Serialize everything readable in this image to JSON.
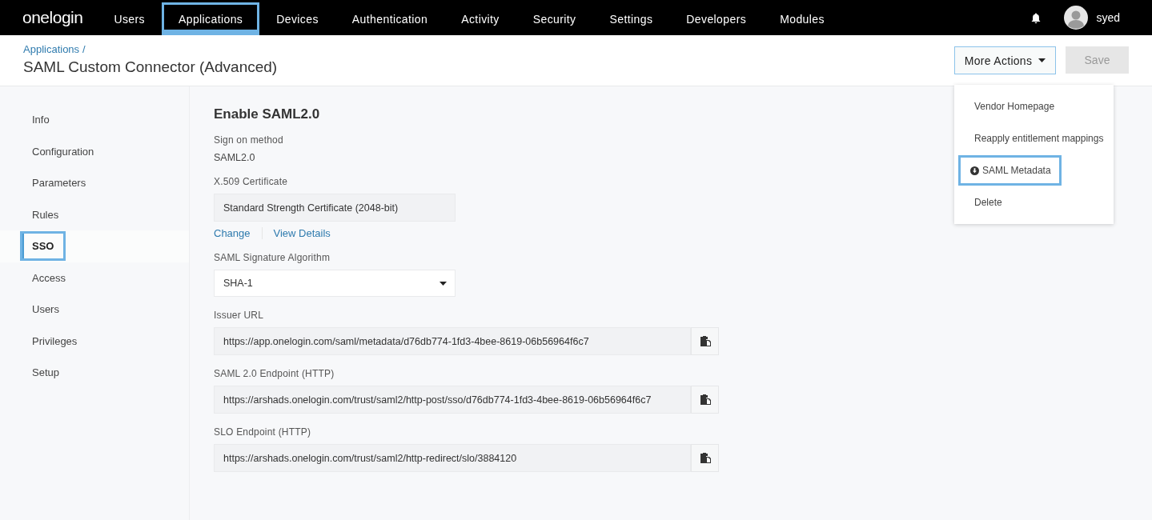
{
  "nav": {
    "logo": "onelogin",
    "items": [
      {
        "label": "Users",
        "selected": false,
        "highlighted": false
      },
      {
        "label": "Applications",
        "selected": true,
        "highlighted": true
      },
      {
        "label": "Devices",
        "selected": false,
        "highlighted": false
      },
      {
        "label": "Authentication",
        "selected": false,
        "highlighted": false
      },
      {
        "label": "Activity",
        "selected": false,
        "highlighted": false
      },
      {
        "label": "Security",
        "selected": false,
        "highlighted": false
      },
      {
        "label": "Settings",
        "selected": false,
        "highlighted": false
      },
      {
        "label": "Developers",
        "selected": false,
        "highlighted": false
      },
      {
        "label": "Modules",
        "selected": false,
        "highlighted": false
      }
    ],
    "user": "syed"
  },
  "header": {
    "breadcrumb": {
      "link": "Applications",
      "separator": "/"
    },
    "title": "SAML Custom Connector (Advanced)",
    "more_actions": {
      "label": "More Actions",
      "expanded": true
    },
    "save": {
      "label": "Save",
      "disabled": true
    }
  },
  "menu": [
    {
      "label": "Vendor Homepage",
      "kind": "plain",
      "highlighted": false
    },
    {
      "label": "Reapply entitlement mappings",
      "kind": "plain",
      "highlighted": false
    },
    {
      "label": "SAML Metadata",
      "kind": "download",
      "highlighted": true
    },
    {
      "label": "Delete",
      "kind": "plain",
      "highlighted": false
    }
  ],
  "sidebar": [
    {
      "label": "Info",
      "selected": false,
      "highlighted": false
    },
    {
      "label": "Configuration",
      "selected": false,
      "highlighted": false
    },
    {
      "label": "Parameters",
      "selected": false,
      "highlighted": false
    },
    {
      "label": "Rules",
      "selected": false,
      "highlighted": false
    },
    {
      "label": "SSO",
      "selected": true,
      "highlighted": true
    },
    {
      "label": "Access",
      "selected": false,
      "highlighted": false
    },
    {
      "label": "Users",
      "selected": false,
      "highlighted": false
    },
    {
      "label": "Privileges",
      "selected": false,
      "highlighted": false
    },
    {
      "label": "Setup",
      "selected": false,
      "highlighted": false
    }
  ],
  "section_title": "Enable SAML2.0",
  "fields": [
    {
      "kind": "static",
      "label": "Sign on method",
      "value": "SAML2.0"
    },
    {
      "kind": "certificate",
      "label": "X.509 Certificate",
      "value": "Standard Strength Certificate (2048-bit)",
      "links": [
        "Change",
        "View Details"
      ]
    },
    {
      "kind": "select",
      "label": "SAML Signature Algorithm",
      "value": "SHA-1"
    },
    {
      "kind": "copy",
      "label": "Issuer URL",
      "value": "https://app.onelogin.com/saml/metadata/d76db774-1fd3-4bee-8619-06b56964f6c7"
    },
    {
      "kind": "copy",
      "label": "SAML 2.0 Endpoint (HTTP)",
      "value": "https://arshads.onelogin.com/trust/saml2/http-post/sso/d76db774-1fd3-4bee-8619-06b56964f6c7"
    },
    {
      "kind": "copy",
      "label": "SLO Endpoint (HTTP)",
      "value": "https://arshads.onelogin.com/trust/saml2/http-redirect/slo/3884120"
    }
  ]
}
